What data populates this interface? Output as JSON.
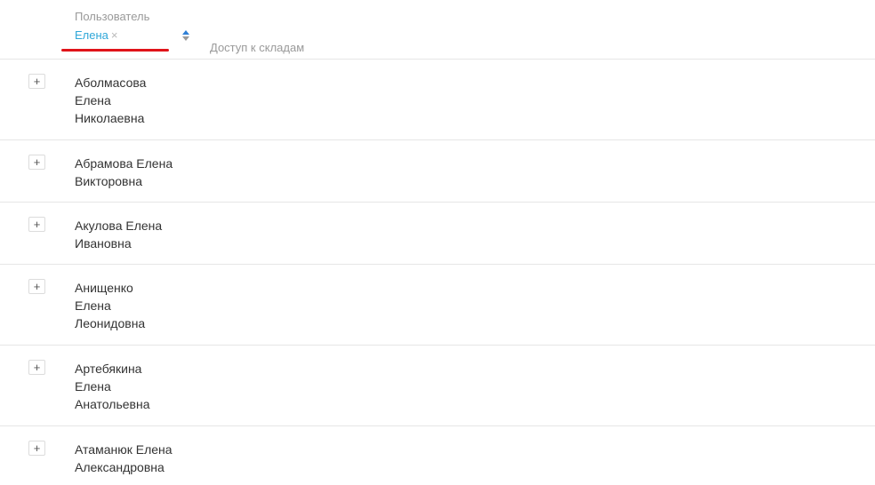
{
  "header": {
    "user_column_label": "Пользователь",
    "filter": {
      "value": "Елена",
      "clear_glyph": "×"
    },
    "stock_access_label": "Доступ к складам"
  },
  "colors": {
    "filter_accent": "#2fa7d8",
    "underline": "#e0141a",
    "muted": "#9a9a9a",
    "sort_active": "#2f80d6"
  },
  "icons": {
    "sort": "sort-arrows-icon",
    "expand": "plus-icon",
    "clear": "close-icon"
  },
  "rows": [
    {
      "expand_label": "+",
      "name": "Аболмасова\nЕлена\nНиколаевна"
    },
    {
      "expand_label": "+",
      "name": "Абрамова Елена\nВикторовна"
    },
    {
      "expand_label": "+",
      "name": "Акулова Елена\nИвановна"
    },
    {
      "expand_label": "+",
      "name": "Анищенко\nЕлена\nЛеонидовна"
    },
    {
      "expand_label": "+",
      "name": "Артебякина\nЕлена\nАнатольевна"
    },
    {
      "expand_label": "+",
      "name": "Атаманюк Елена\nАлександровна"
    }
  ]
}
